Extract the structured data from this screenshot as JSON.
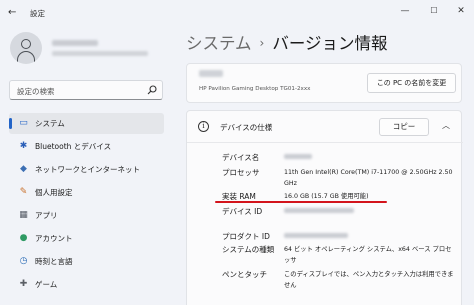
{
  "window": {
    "title": "設定",
    "back_glyph": "←",
    "min_glyph": "—",
    "max_glyph": "☐",
    "close_glyph": "✕"
  },
  "search": {
    "placeholder": "設定の検索"
  },
  "nav": {
    "items": [
      {
        "label": "システム",
        "icon": "monitor-icon",
        "glyph": "▭",
        "color": "#2364c7",
        "active": true
      },
      {
        "label": "Bluetooth とデバイス",
        "icon": "bluetooth-icon",
        "glyph": "✱",
        "color": "#2b5fb8",
        "active": false
      },
      {
        "label": "ネットワークとインターネット",
        "icon": "wifi-icon",
        "glyph": "◆",
        "color": "#3c6fb3",
        "active": false
      },
      {
        "label": "個人用設定",
        "icon": "brush-icon",
        "glyph": "✎",
        "color": "#c9702b",
        "active": false
      },
      {
        "label": "アプリ",
        "icon": "apps-icon",
        "glyph": "▦",
        "color": "#555b66",
        "active": false
      },
      {
        "label": "アカウント",
        "icon": "account-icon",
        "glyph": "●",
        "color": "#2f9a63",
        "active": false
      },
      {
        "label": "時刻と言語",
        "icon": "globe-clock-icon",
        "glyph": "◷",
        "color": "#2a6bb5",
        "active": false
      },
      {
        "label": "ゲーム",
        "icon": "gamepad-icon",
        "glyph": "✚",
        "color": "#5b5f66",
        "active": false
      }
    ]
  },
  "breadcrumb": {
    "parent": "システム",
    "separator": "›",
    "current": "バージョン情報"
  },
  "device": {
    "model": "HP Pavilion Gaming Desktop TG01-2xxx",
    "rename_label": "この PC の名前を変更"
  },
  "specs": {
    "title": "デバイスの仕様",
    "copy_label": "コピー",
    "collapse_glyph": "︿",
    "rows": [
      {
        "label": "デバイス名",
        "value": ""
      },
      {
        "label": "プロセッサ",
        "value": "11th Gen Intel(R) Core(TM) i7-11700 @ 2.50GHz   2.50 GHz"
      },
      {
        "label": "実装 RAM",
        "value": "16.0 GB (15.7 GB 使用可能)"
      },
      {
        "label": "デバイス ID",
        "value": ""
      },
      {
        "label": "プロダクト ID",
        "value": ""
      },
      {
        "label": "システムの種類",
        "value": "64 ビット オペレーティング システム、x64 ベース プロセッサ"
      },
      {
        "label": "ペンとタッチ",
        "value": "このディスプレイでは、ペン入力とタッチ入力は利用できません"
      }
    ]
  },
  "colors": {
    "accent": "#2364c7",
    "highlight_underline": "#d3141c"
  }
}
